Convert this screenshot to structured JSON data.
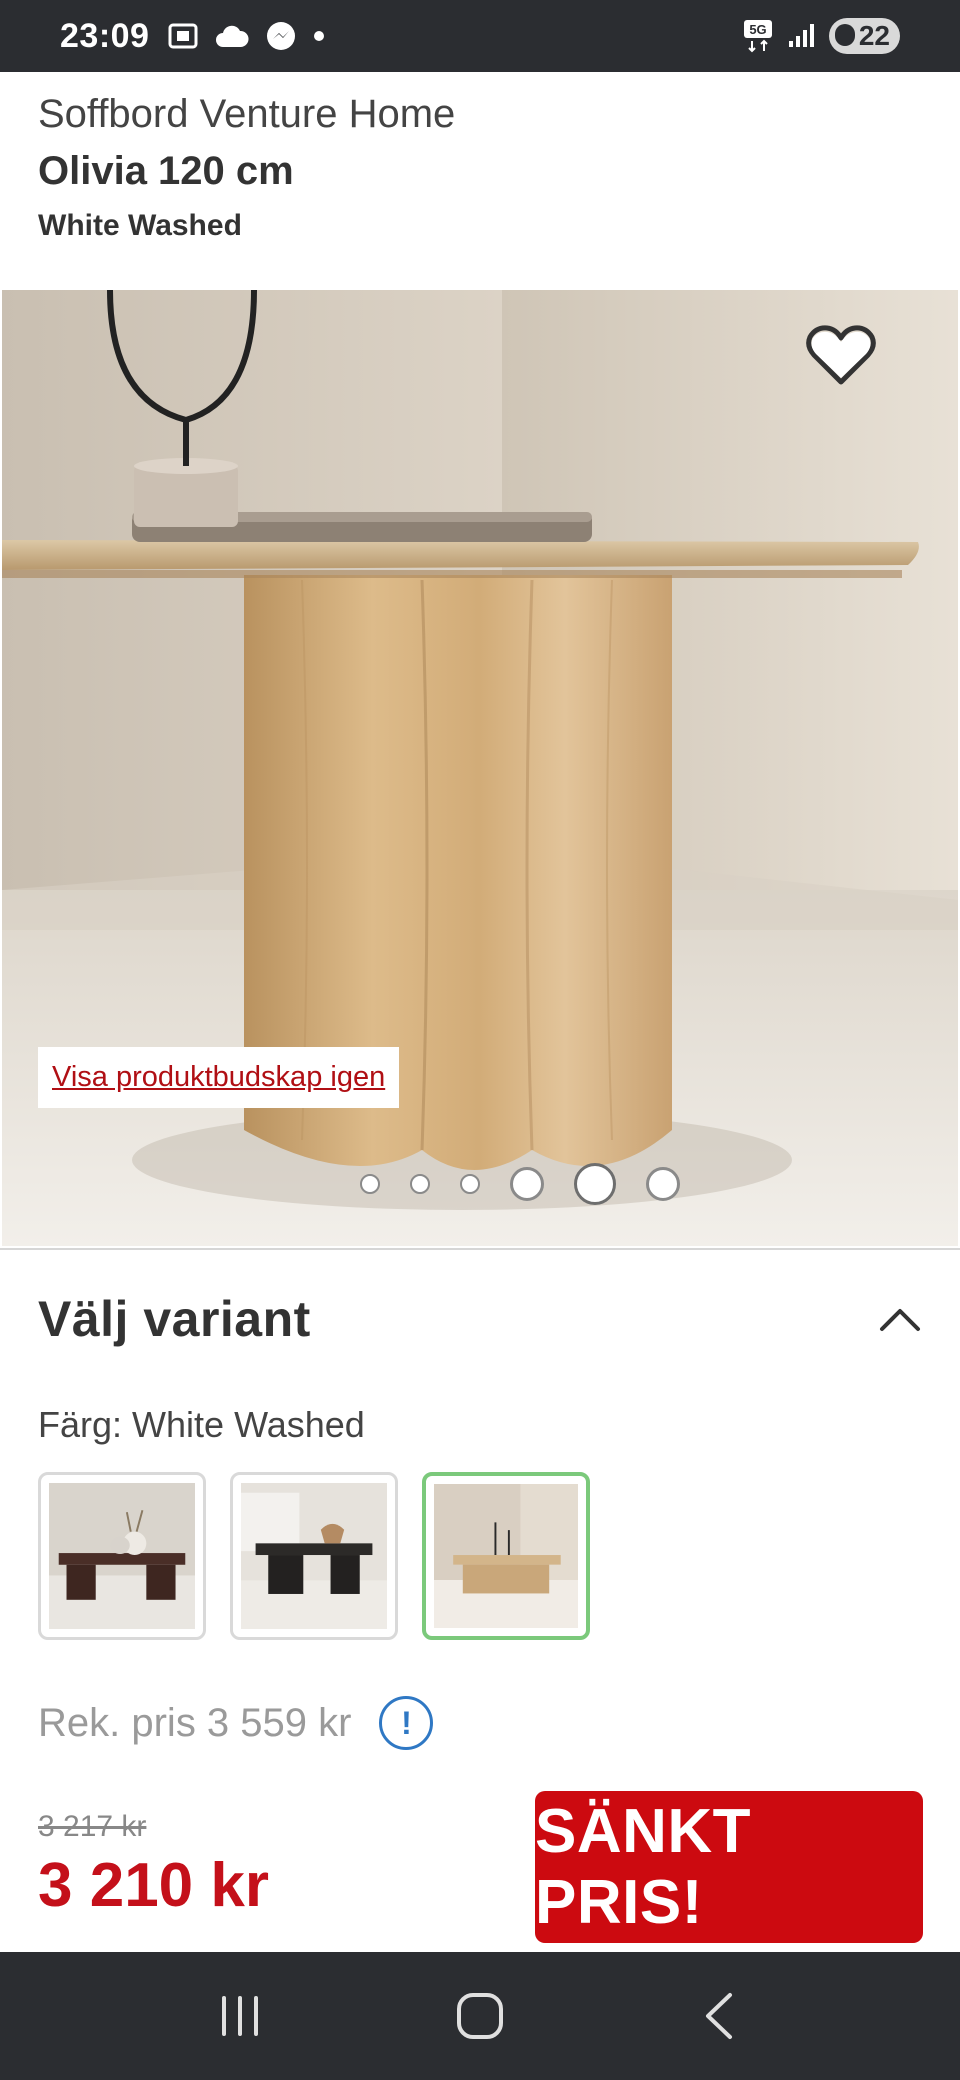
{
  "status_bar": {
    "time": "23:09",
    "network": "5G",
    "battery": "22"
  },
  "product": {
    "brand_line": "Soffbord Venture Home",
    "name": "Olivia 120 cm",
    "variant": "White Washed"
  },
  "gallery": {
    "message_link": "Visa produktbudskap igen",
    "dots_count": 6,
    "active_dot": 5
  },
  "variant_section": {
    "title": "Välj variant",
    "color_label": "Färg:",
    "color_value": "White Washed",
    "swatches": [
      "dark-brown-table",
      "black-table",
      "white-washed-table"
    ],
    "selected_swatch": 3
  },
  "pricing": {
    "rek_label": "Rek. pris 3 559 kr",
    "old_price": "3 217 kr",
    "new_price": "3 210 kr",
    "badge": "SÄNKT PRIS!"
  },
  "colors": {
    "price_red": "#c4101a",
    "badge_red": "#cc0a10",
    "selected_green": "#7bc97b",
    "info_blue": "#2f78c4"
  }
}
